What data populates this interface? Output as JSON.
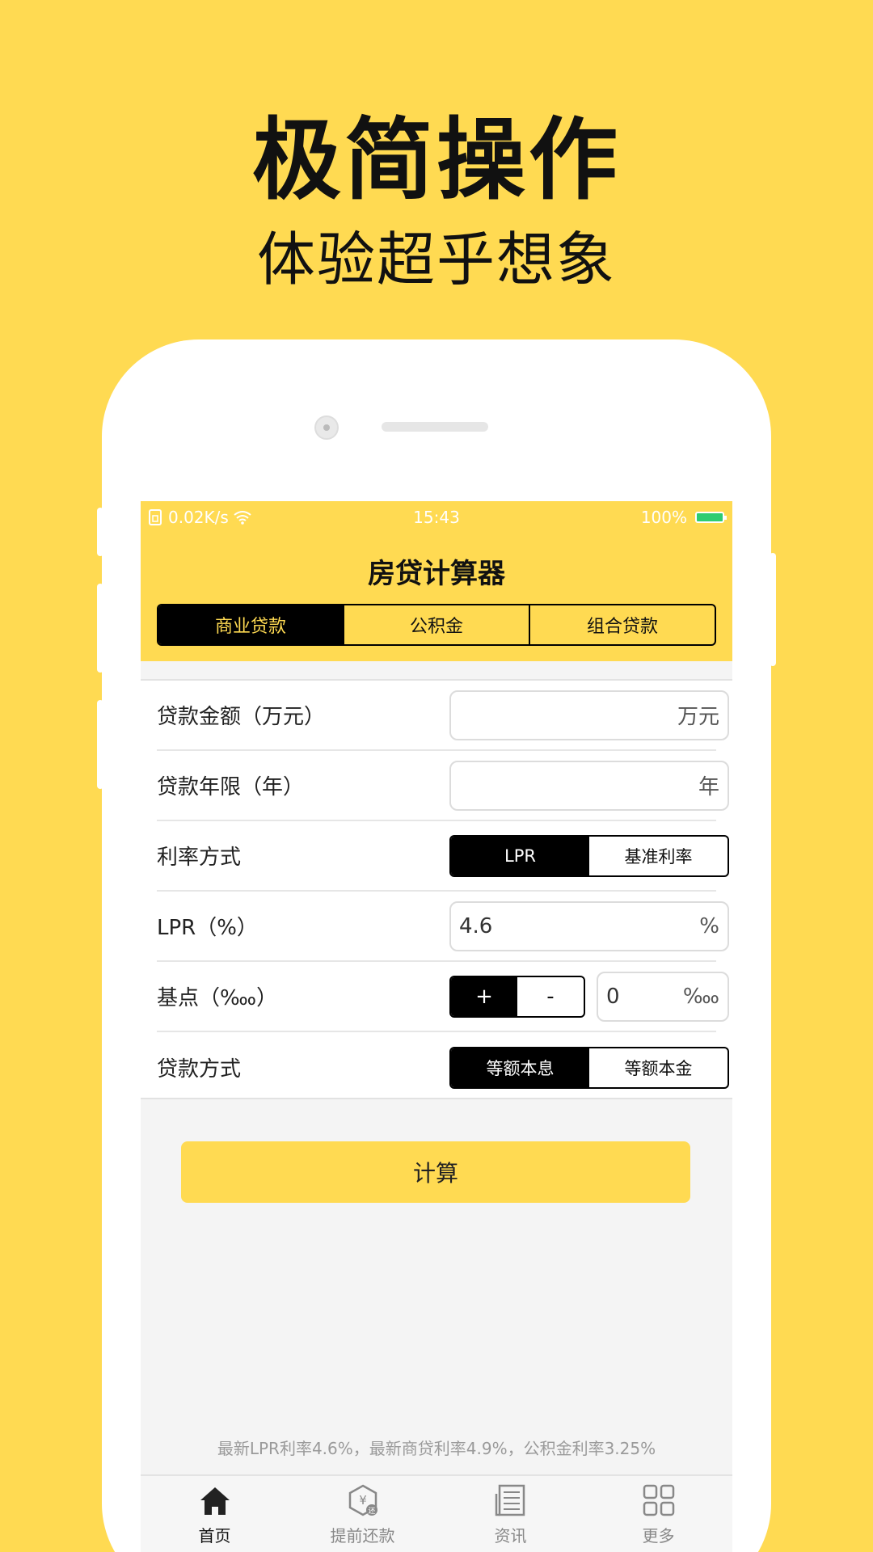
{
  "headline": "极简操作",
  "subline": "体验超乎想象",
  "colors": {
    "accent": "#FFDA52",
    "dark": "#000000",
    "battery": "#2ECC71"
  },
  "status": {
    "network": "0.02K/s",
    "time": "15:43",
    "battery": "100%"
  },
  "app": {
    "title": "房贷计算器"
  },
  "loan_types": [
    "商业贷款",
    "公积金",
    "组合贷款"
  ],
  "form": {
    "amount": {
      "label": "贷款金额（万元）",
      "value": "",
      "unit": "万元"
    },
    "term": {
      "label": "贷款年限（年）",
      "value": "",
      "unit": "年"
    },
    "rate_mode": {
      "label": "利率方式",
      "options": [
        "LPR",
        "基准利率"
      ],
      "selected": "LPR"
    },
    "lpr": {
      "label": "LPR（%）",
      "value": "4.6",
      "unit": "%"
    },
    "basis": {
      "label": "基点（‱）",
      "plus": "+",
      "minus": "-",
      "value": "0",
      "unit": "‱"
    },
    "repay_mode": {
      "label": "贷款方式",
      "options": [
        "等额本息",
        "等额本金"
      ],
      "selected": "等额本息"
    }
  },
  "calc_button": "计算",
  "note": "最新LPR利率4.6%，最新商贷利率4.9%，公积金利率3.25%",
  "tabs": [
    {
      "label": "首页",
      "icon": "home-icon",
      "active": true
    },
    {
      "label": "提前还款",
      "icon": "repay-icon",
      "active": false
    },
    {
      "label": "资讯",
      "icon": "news-icon",
      "active": false
    },
    {
      "label": "更多",
      "icon": "grid-icon",
      "active": false
    }
  ]
}
